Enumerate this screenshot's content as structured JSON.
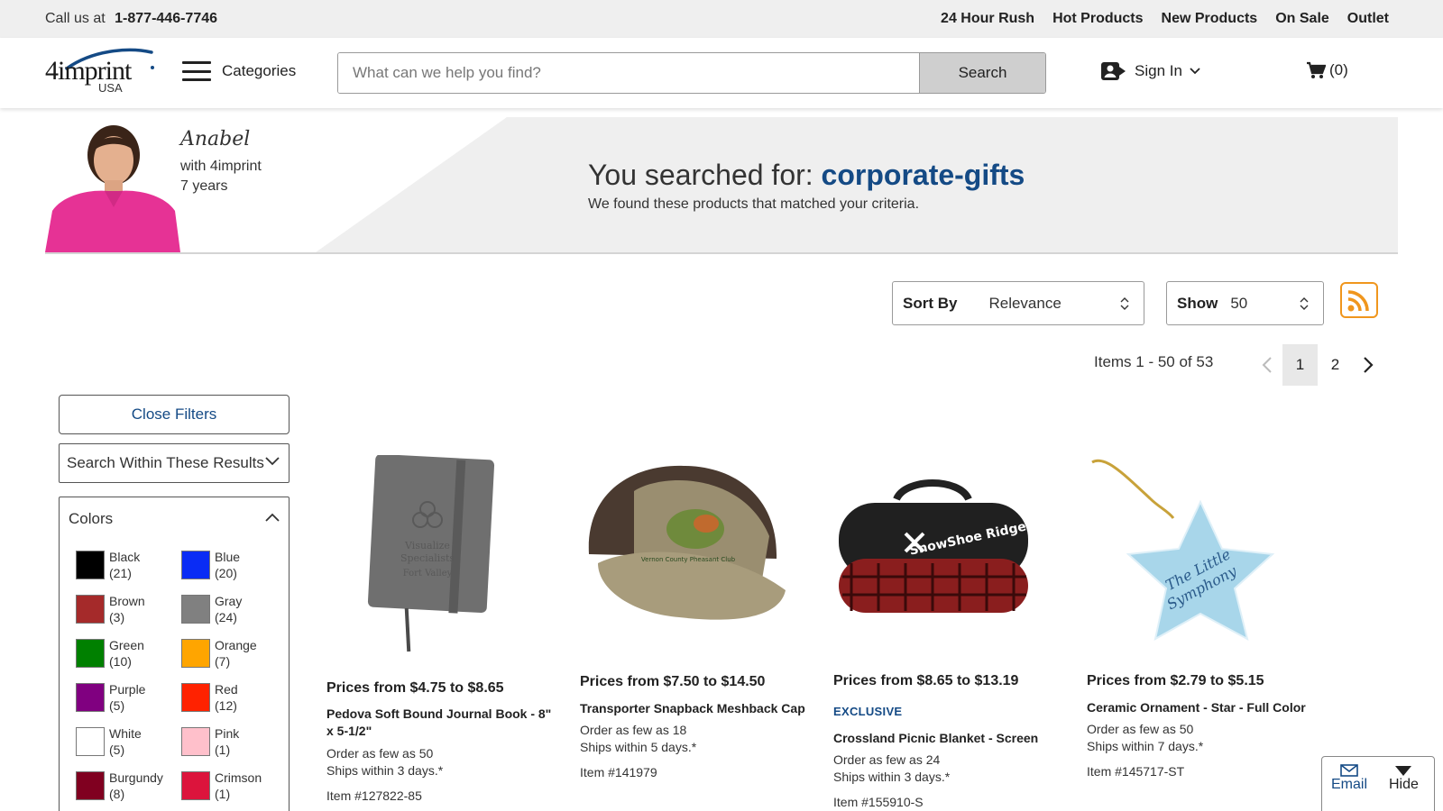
{
  "topbar": {
    "call_label": "Call us at",
    "phone": "1-877-446-7746",
    "links": [
      "24 Hour Rush",
      "Hot Products",
      "New Products",
      "On Sale",
      "Outlet"
    ]
  },
  "header": {
    "logo_text": "4imprint",
    "logo_region": "USA",
    "categories_label": "Categories",
    "search_placeholder": "What can we help you find?",
    "search_button": "Search",
    "signin_label": "Sign In",
    "cart_label": "(0)"
  },
  "banner": {
    "rep_name": "Anabel",
    "rep_with": "with 4imprint",
    "rep_years": "7 years",
    "searched_prefix": "You searched for:",
    "search_term": "corporate-gifts",
    "subtitle": "We found these products that matched your criteria."
  },
  "controls": {
    "sort_label": "Sort By",
    "sort_value": "Relevance",
    "show_label": "Show",
    "show_value": "50",
    "items_count": "Items 1 - 50 of 53",
    "pages": [
      "1",
      "2"
    ],
    "active_page": "1"
  },
  "filters": {
    "close_label": "Close Filters",
    "within_label": "Search Within These Results",
    "colors_title": "Colors",
    "colors": [
      {
        "name": "Black",
        "count": "(21)",
        "hex": "#000000"
      },
      {
        "name": "Blue",
        "count": "(20)",
        "hex": "#0a2cf5"
      },
      {
        "name": "Brown",
        "count": "(3)",
        "hex": "#a52a2a"
      },
      {
        "name": "Gray",
        "count": "(24)",
        "hex": "#808080"
      },
      {
        "name": "Green",
        "count": "(10)",
        "hex": "#008000"
      },
      {
        "name": "Orange",
        "count": "(7)",
        "hex": "#ffa500"
      },
      {
        "name": "Purple",
        "count": "(5)",
        "hex": "#800080"
      },
      {
        "name": "Red",
        "count": "(12)",
        "hex": "#ff2200"
      },
      {
        "name": "White",
        "count": "(5)",
        "hex": "#ffffff"
      },
      {
        "name": "Pink",
        "count": "(1)",
        "hex": "#ffc0cb"
      },
      {
        "name": "Burgundy",
        "count": "(8)",
        "hex": "#800020"
      },
      {
        "name": "Crimson",
        "count": "(1)",
        "hex": "#dc143c"
      }
    ]
  },
  "products": [
    {
      "price": "Prices from $4.75 to $8.65",
      "name": "Pedova Soft Bound Journal Book - 8\" x 5-1/2\"",
      "exclusive": "",
      "order": "Order as few as 50",
      "ships": "Ships within 3 days.*",
      "item": "Item #127822-85",
      "image_label": "Visualize Specialists Fort Valley"
    },
    {
      "price": "Prices from $7.50 to $14.50",
      "name": "Transporter Snapback Meshback Cap",
      "exclusive": "",
      "order": "Order as few as 18",
      "ships": "Ships within 5 days.*",
      "item": "Item #141979",
      "image_label": "Vernon County Pheasant Club"
    },
    {
      "price": "Prices from $8.65 to $13.19",
      "name": "Crossland Picnic Blanket - Screen",
      "exclusive": "EXCLUSIVE",
      "order": "Order as few as 24",
      "ships": "Ships within 3 days.*",
      "item": "Item #155910-S",
      "image_label": "SnowShoe Ridge"
    },
    {
      "price": "Prices from $2.79 to $5.15",
      "name": "Ceramic Ornament - Star - Full Color",
      "exclusive": "",
      "order": "Order as few as 50",
      "ships": "Ships within 7 days.*",
      "item": "Item #145717-ST",
      "image_label": "The Little Symphony"
    }
  ],
  "fab": {
    "email_label": "Email",
    "hide_label": "Hide"
  },
  "colors": {
    "brand_blue": "#144a85",
    "topbar_bg": "#efefef",
    "rss_orange": "#f0961d"
  }
}
